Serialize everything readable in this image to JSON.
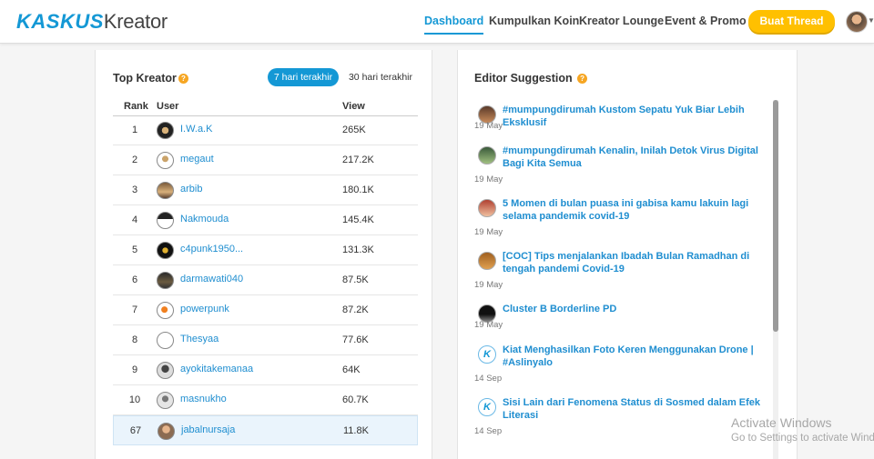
{
  "header": {
    "logo_part1": "KASKUS",
    "logo_part2": "Kreator",
    "nav": [
      {
        "label": "Dashboard",
        "active": true
      },
      {
        "label": "Kumpulkan Koin",
        "active": false
      },
      {
        "label": "Kreator Lounge",
        "active": false
      },
      {
        "label": "Event & Promo",
        "active": false
      }
    ],
    "cta_label": "Buat Thread"
  },
  "top_kreator": {
    "title": "Top Kreator",
    "help_glyph": "?",
    "filters": [
      {
        "label": "7 hari terakhir",
        "selected": true
      },
      {
        "label": "30 hari terakhir",
        "selected": false
      }
    ],
    "columns": {
      "rank": "Rank",
      "user": "User",
      "view": "View"
    },
    "rows": [
      {
        "rank": "1",
        "user": "I.W.a.K",
        "view": "265K"
      },
      {
        "rank": "2",
        "user": "megaut",
        "view": "217.2K"
      },
      {
        "rank": "3",
        "user": "arbib",
        "view": "180.1K"
      },
      {
        "rank": "4",
        "user": "Nakmouda",
        "view": "145.4K"
      },
      {
        "rank": "5",
        "user": "c4punk1950...",
        "view": "131.3K"
      },
      {
        "rank": "6",
        "user": "darmawati040",
        "view": "87.5K"
      },
      {
        "rank": "7",
        "user": "powerpunk",
        "view": "87.2K"
      },
      {
        "rank": "8",
        "user": "Thesyaa",
        "view": "77.6K"
      },
      {
        "rank": "9",
        "user": "ayokitakemanaa",
        "view": "64K"
      },
      {
        "rank": "10",
        "user": "masnukho",
        "view": "60.7K"
      },
      {
        "rank": "67",
        "user": "jabalnursaja",
        "view": "11.8K",
        "highlight": true
      }
    ]
  },
  "editor_suggestion": {
    "title": "Editor Suggestion",
    "help_glyph": "?",
    "items": [
      {
        "title": "#mumpungdirumah Kustom Sepatu Yuk Biar Lebih Eksklusif",
        "date": "19 May"
      },
      {
        "title": "#mumpungdirumah Kenalin, Inilah Detok Virus Digital Bagi Kita Semua",
        "date": "19 May"
      },
      {
        "title": "5 Momen di bulan puasa ini gabisa kamu lakuin lagi selama pandemik covid-19",
        "date": "19 May"
      },
      {
        "title": "[COC] Tips menjalankan Ibadah Bulan Ramadhan di tengah pandemi Covid-19",
        "date": "19 May"
      },
      {
        "title": "Cluster B Borderline PD",
        "date": "19 May"
      },
      {
        "title": "Kiat Menghasilkan Foto Keren Menggunakan Drone | #Aslinyalo",
        "date": "14 Sep"
      },
      {
        "title": "Sisi Lain dari Fenomena Status di Sosmed dalam Efek Literasi",
        "date": "14 Sep"
      }
    ]
  },
  "watermark": {
    "line1": "Activate Windows",
    "line2": "Go to Settings to activate Windows."
  }
}
